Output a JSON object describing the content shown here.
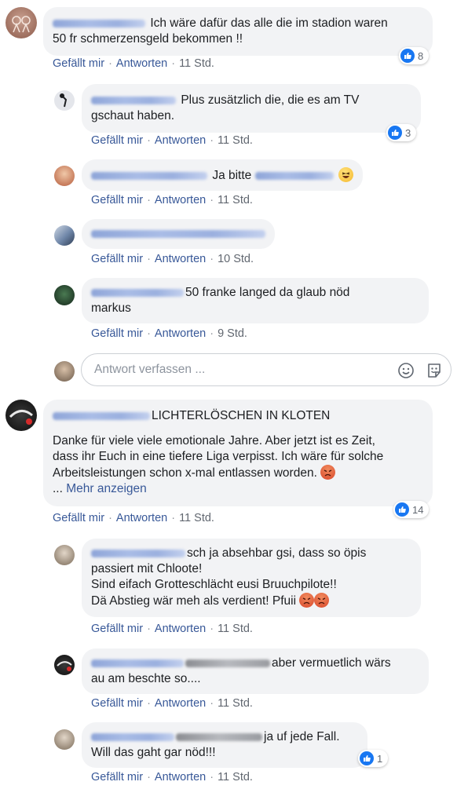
{
  "actions": {
    "like": "Gefällt mir",
    "reply": "Antworten",
    "separator": "·"
  },
  "reply_box": {
    "placeholder": "Antwort verfassen ...",
    "icons": [
      "smiley-icon",
      "sticker-icon"
    ]
  },
  "colors": {
    "link": "#385898",
    "bubble": "#f2f3f5",
    "like_blue": "#1877f2",
    "timestamp": "#616770"
  },
  "comments": [
    {
      "lines": [
        "Ich wäre dafür das alle die im stadion waren",
        "50 fr schmerzensgeld bekommen !!"
      ],
      "time": "11 Std.",
      "reactions": "8"
    },
    {
      "lines": [
        "Plus zusätzlich die, die es am TV",
        "gschaut haben."
      ],
      "time": "11 Std.",
      "reactions": "3"
    },
    {
      "lines": [
        "Ja bitte"
      ],
      "time": "11 Std."
    },
    {
      "lines": [],
      "time": "10 Std."
    },
    {
      "lines": [
        "50 franke langed da glaub nöd",
        "markus"
      ],
      "time": "9 Std."
    },
    {
      "header": "LICHTERLÖSCHEN IN KLOTEN",
      "lines": [
        "Danke für viele viele emotionale Jahre. Aber jetzt ist es Zeit,",
        "dass ihr Euch in eine tiefere Liga verpisst. Ich wäre für solche",
        "Arbeitsleistungen schon x-mal entlassen worden."
      ],
      "more_prefix": "...",
      "more": "Mehr anzeigen",
      "time": "11 Std.",
      "reactions": "14"
    },
    {
      "lines": [
        "sch ja absehbar gsi, dass so öpis",
        "passiert mit Chloote!",
        "Sind eifach Grotteschlächt eusi Bruuchpilote!!",
        "Dä Abstieg wär meh als verdient! Pfuii"
      ],
      "time": "11 Std."
    },
    {
      "lines": [
        "aber vermuetlich wärs",
        "au am beschte so...."
      ],
      "time": "11 Std."
    },
    {
      "lines": [
        "ja uf jede Fall.",
        "Will das gaht gar nöd!!!"
      ],
      "time": "11 Std.",
      "reactions": "1"
    }
  ]
}
